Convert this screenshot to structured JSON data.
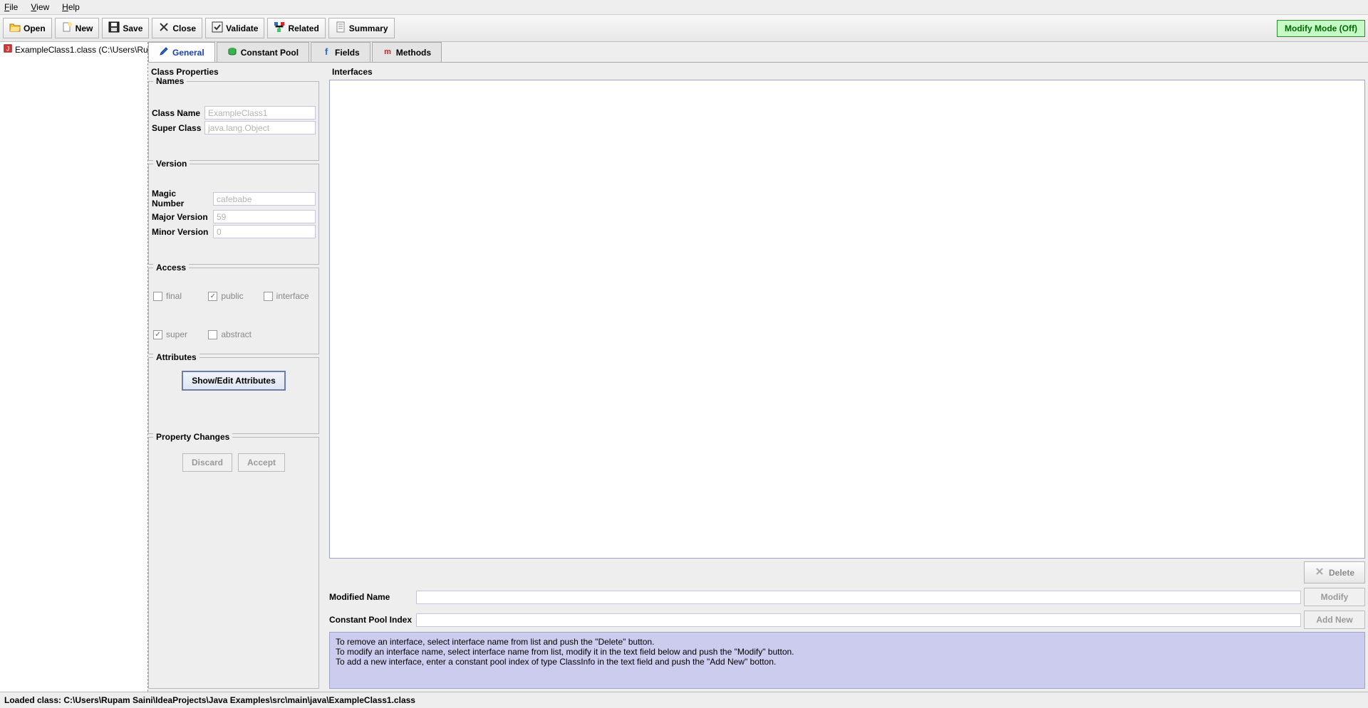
{
  "menubar": {
    "file": "File",
    "view": "View",
    "help": "Help"
  },
  "toolbar": {
    "open": "Open",
    "new": "New",
    "save": "Save",
    "close": "Close",
    "validate": "Validate",
    "related": "Related",
    "summary": "Summary",
    "modify_mode": "Modify Mode (Off)"
  },
  "tree": {
    "item": "ExampleClass1.class (C:\\Users\\Ru"
  },
  "tabs": {
    "general": "General",
    "constant_pool": "Constant Pool",
    "fields": "Fields",
    "methods": "Methods"
  },
  "class_properties": {
    "title": "Class Properties",
    "names_legend": "Names",
    "class_name_label": "Class Name",
    "class_name_value": "ExampleClass1",
    "super_class_label": "Super Class",
    "super_class_value": "java.lang.Object",
    "version_legend": "Version",
    "magic_label": "Magic Number",
    "magic_value": "cafebabe",
    "major_label": "Major Version",
    "major_value": "59",
    "minor_label": "Minor Version",
    "minor_value": "0",
    "access_legend": "Access",
    "access": {
      "final": "final",
      "public": "public",
      "interface": "interface",
      "super": "super",
      "abstract": "abstract"
    },
    "attributes_legend": "Attributes",
    "show_edit": "Show/Edit Attributes",
    "changes_legend": "Property Changes",
    "discard": "Discard",
    "accept": "Accept"
  },
  "interfaces": {
    "title": "Interfaces",
    "delete": "Delete",
    "modified_name": "Modified Name",
    "modify": "Modify",
    "constant_pool_index": "Constant Pool Index",
    "add_new": "Add New",
    "help_line1": "To remove an interface, select interface name from list and push the \"Delete\" button.",
    "help_line2": "To modify an interface name, select interface name from list, modify it in the text field below and push the \"Modify\" button.",
    "help_line3": "To add a new interface, enter a constant pool index of type ClassInfo in the text field and push the \"Add New\" botton."
  },
  "status": "Loaded class: C:\\Users\\Rupam Saini\\IdeaProjects\\Java Examples\\src\\main\\java\\ExampleClass1.class"
}
